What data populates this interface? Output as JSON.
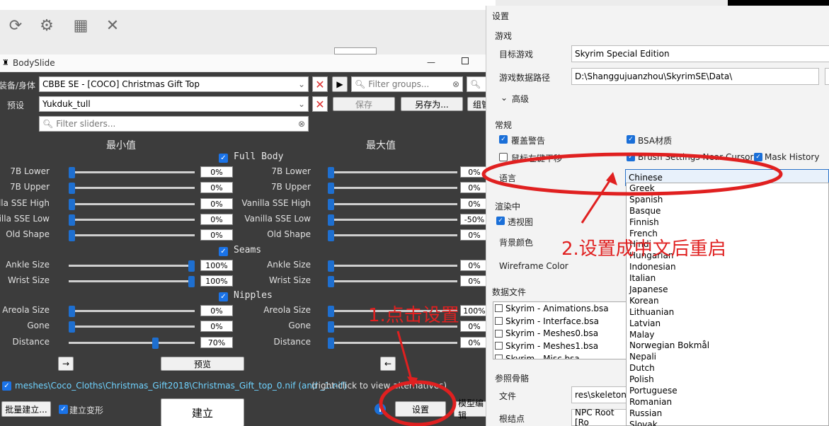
{
  "toolbar": {
    "icons": [
      "refresh-icon",
      "gears-icon",
      "build-icon",
      "tools-icon"
    ]
  },
  "bodyslide": {
    "title": "BodySlide",
    "outfit_label": "装备/身体",
    "outfit_value": "CBBE SE - [COCO] Christmas Gift Top",
    "filter_groups_placeholder": "Filter groups...",
    "preset_label": "预设",
    "preset_value": "Yukduk_tull",
    "save_label": "保存",
    "save_as_label": "另存为...",
    "group_label": "组管",
    "filter_sliders_placeholder": "Filter sliders...",
    "min_header": "最小值",
    "max_header": "最大值",
    "sections": [
      {
        "name": "Full Body",
        "rows": [
          {
            "label": "7B Lower",
            "min": "0%",
            "max": "0%"
          },
          {
            "label": "7B Upper",
            "min": "0%",
            "max": "0%"
          },
          {
            "label": "Vanilla SSE High",
            "min": "0%",
            "max": "0%"
          },
          {
            "label": "Vanilla SSE Low",
            "min": "0%",
            "max": "-50%"
          },
          {
            "label": "Old Shape",
            "min": "0%",
            "max": "0%"
          }
        ]
      },
      {
        "name": "Seams",
        "rows": [
          {
            "label": "Ankle Size",
            "min": "100%",
            "max": "0%"
          },
          {
            "label": "Wrist Size",
            "min": "100%",
            "max": "0%"
          }
        ]
      },
      {
        "name": "Nipples",
        "rows": [
          {
            "label": "Areola Size",
            "min": "0%",
            "max": "100%"
          },
          {
            "label": "Gone",
            "min": "0%",
            "max": "0%"
          },
          {
            "label": "Distance",
            "min": "70%",
            "max": "0%"
          }
        ]
      }
    ],
    "arrow_right": "→",
    "preview_label": "预览",
    "arrow_left": "←",
    "output_path": "meshes\\Coco_Cloths\\Christmas_Gift2018\\Christmas_Gift_top_0.nif (and _1.nif)",
    "output_hint": "(right-click to view alternatives)",
    "batch_build_label": "批量建立...",
    "build_morphs_label": "建立变形",
    "build_label": "建立",
    "info_label": "i",
    "settings_label": "设置",
    "outfit_studio_label": "模型编辑"
  },
  "settings": {
    "title": "设置",
    "game_group": "游戏",
    "target_game_label": "目标游戏",
    "target_game_value": "Skyrim Special Edition",
    "game_data_path_label": "游戏数据路径",
    "game_data_path_value": "D:\\Shanggujuanzhou\\SkyrimSE\\Data\\",
    "advanced_label": "高级",
    "general_group": "常规",
    "overwrite_warn_label": "覆盖警告",
    "bsa_textures_label": "BSA材质",
    "mouse_left_pan_label": "鼠标左键平移",
    "brush_settings_label": "Brush Settings Near Cursor",
    "mask_history_label": "Mask History",
    "language_label": "语言",
    "language_value": "Chinese",
    "languages": [
      "Greek",
      "Spanish",
      "Basque",
      "Finnish",
      "French",
      "Hindi",
      "Hungarian",
      "Indonesian",
      "Italian",
      "Japanese",
      "Korean",
      "Lithuanian",
      "Latvian",
      "Malay",
      "Norwegian Bokmål",
      "Nepali",
      "Dutch",
      "Polish",
      "Portuguese",
      "Romanian",
      "Russian",
      "Slovak"
    ],
    "render_group": "渲染中",
    "perspective_label": "透视图",
    "bg_color_label": "背景颜色",
    "wireframe_color_label": "Wireframe Color",
    "data_files_group": "数据文件",
    "data_files": [
      "Skyrim - Animations.bsa",
      "Skyrim - Interface.bsa",
      "Skyrim - Meshes0.bsa",
      "Skyrim - Meshes1.bsa",
      "Skyrim - Misc.bsa"
    ],
    "ref_skeleton_group": "参照骨骼",
    "file_label": "文件",
    "file_value": "res\\skeleton_",
    "root_node_label": "根结点",
    "root_node_value": "NPC Root [Ro"
  },
  "annotations": {
    "step1": "1.点击设置",
    "step2": "2.设置成中文后重启"
  },
  "colors": {
    "annotation": "#e02020",
    "accent": "#1a6fd8",
    "dark_bg": "#3c3c3c",
    "path": "#6fd3ff"
  }
}
